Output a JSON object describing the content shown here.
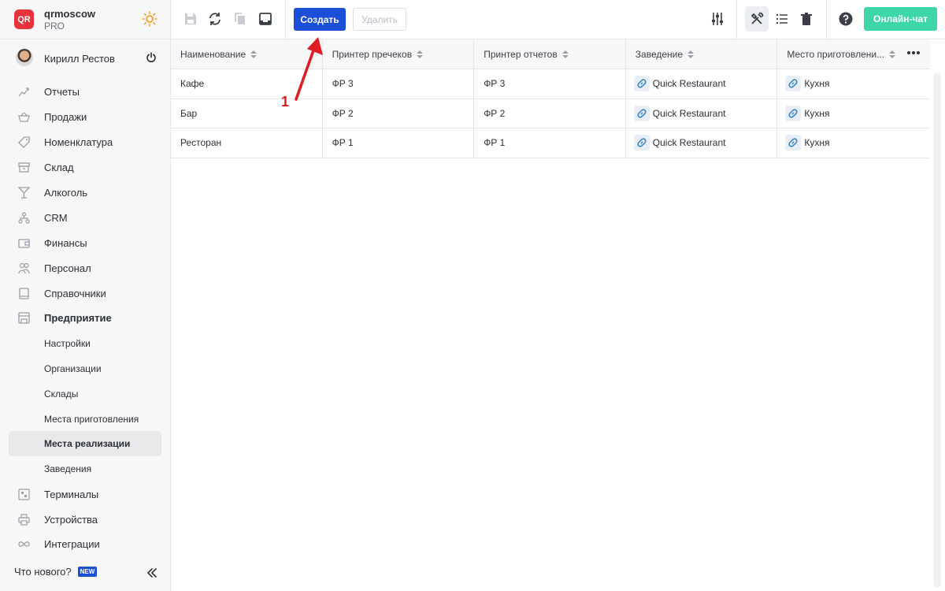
{
  "brand": {
    "name": "qrmoscow",
    "plan": "PRO",
    "logo_text": "QR"
  },
  "user": {
    "name": "Кирилл Рестов"
  },
  "nav": {
    "items": [
      {
        "label": "Отчеты",
        "icon": "chart-icon"
      },
      {
        "label": "Продажи",
        "icon": "basket-icon"
      },
      {
        "label": "Номенклатура",
        "icon": "tag-icon"
      },
      {
        "label": "Склад",
        "icon": "box-icon"
      },
      {
        "label": "Алкоголь",
        "icon": "cocktail-icon"
      },
      {
        "label": "CRM",
        "icon": "hierarchy-icon"
      },
      {
        "label": "Финансы",
        "icon": "wallet-icon"
      },
      {
        "label": "Персонал",
        "icon": "people-icon"
      },
      {
        "label": "Справочники",
        "icon": "book-icon"
      },
      {
        "label": "Предприятие",
        "icon": "store-icon"
      }
    ],
    "sub_items": [
      {
        "label": "Настройки"
      },
      {
        "label": "Организации"
      },
      {
        "label": "Склады"
      },
      {
        "label": "Места приготовления"
      },
      {
        "label": "Места реализации"
      },
      {
        "label": "Заведения"
      }
    ],
    "bottom_items": [
      {
        "label": "Терминалы",
        "icon": "qr-icon"
      },
      {
        "label": "Устройства",
        "icon": "printer-icon"
      },
      {
        "label": "Интеграции",
        "icon": "infinity-icon"
      }
    ],
    "active_sub": "Места реализации"
  },
  "footer": {
    "whats_new": "Что нового?",
    "badge": "NEW"
  },
  "toolbar": {
    "create_label": "Создать",
    "delete_label": "Удалить",
    "chat_label": "Онлайн-чат"
  },
  "table": {
    "columns": [
      "Наименование",
      "Принтер пречеков",
      "Принтер отчетов",
      "Заведение",
      "Место приготовлени..."
    ],
    "rows": [
      [
        "Кафе",
        "ФР 3",
        "ФР 3",
        "Quick Restaurant",
        "Кухня"
      ],
      [
        "Бар",
        "ФР 2",
        "ФР 2",
        "Quick Restaurant",
        "Кухня"
      ],
      [
        "Ресторан",
        "ФР 1",
        "ФР 1",
        "Quick Restaurant",
        "Кухня"
      ]
    ]
  },
  "annotation": {
    "number": "1"
  },
  "colors": {
    "primary": "#1b4fd8",
    "chat": "#3ed6a8",
    "annotation": "#e01b24",
    "logo": "#e8323c"
  }
}
